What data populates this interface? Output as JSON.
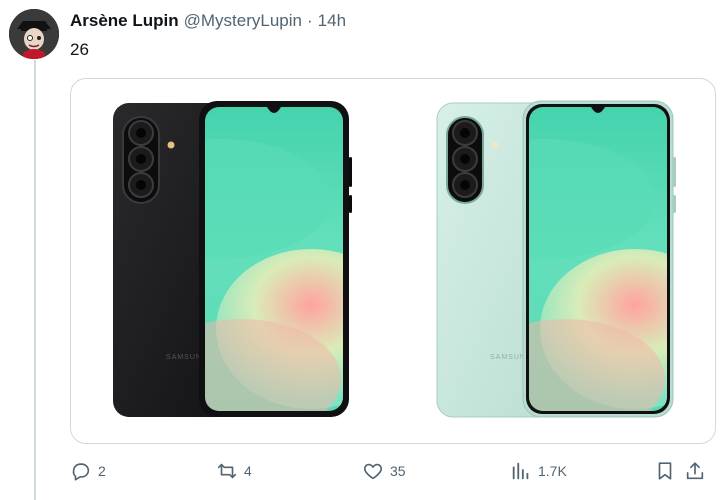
{
  "tweet": {
    "author_name": "Arsène Lupin",
    "author_handle": "@MysteryLupin",
    "separator": "·",
    "time": "14h",
    "text": "26"
  },
  "media": {
    "phones": [
      {
        "color": "black",
        "brand": "SAMSUNG"
      },
      {
        "color": "mint",
        "brand": "SAMSUNG"
      }
    ]
  },
  "actions": {
    "reply_count": "2",
    "retweet_count": "4",
    "like_count": "35",
    "views_count": "1.7K"
  },
  "icons": [
    "reply-icon",
    "retweet-icon",
    "like-icon",
    "views-icon",
    "bookmark-icon",
    "share-icon"
  ],
  "colors": {
    "text_primary": "#0f1419",
    "text_secondary": "#536471",
    "border": "#cfd9de",
    "phone_black": "#1c1c1e",
    "phone_mint": "#c9e8dd",
    "screen_teal": "#4cd6b2"
  }
}
